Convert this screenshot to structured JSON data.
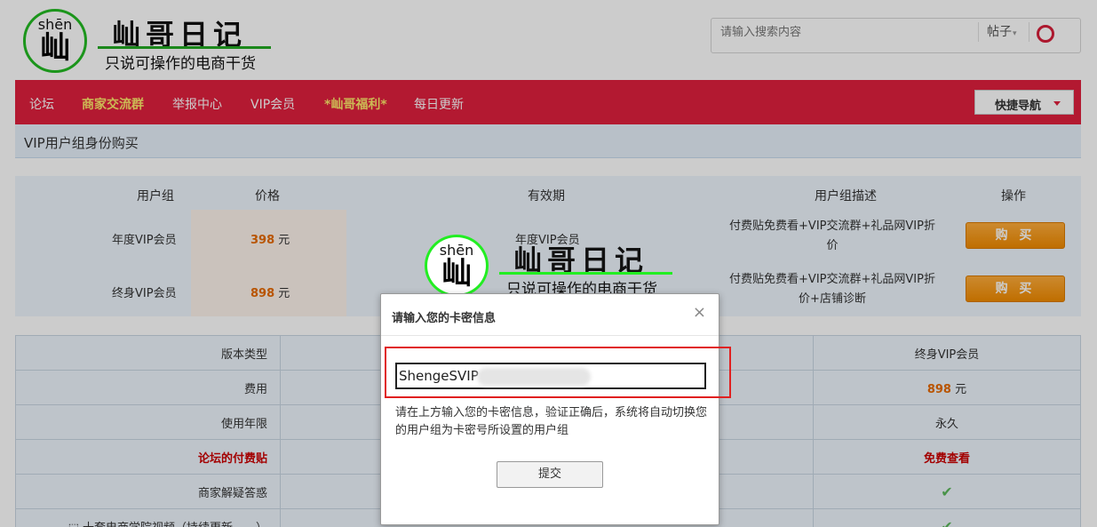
{
  "logo": {
    "pinyin": "shēn",
    "char": "屾",
    "name": "屾哥日记",
    "slogan": "只说可操作的电商干货"
  },
  "search": {
    "placeholder": "请输入搜索内容",
    "type": "帖子"
  },
  "nav": {
    "items": [
      "论坛",
      "商家交流群",
      "举报中心",
      "VIP会员",
      "*屾哥福利*",
      "每日更新"
    ],
    "quick": "快捷导航"
  },
  "subbar": "VIP用户组身份购买",
  "price_table": {
    "headers": [
      "用户组",
      "价格",
      "有效期",
      "用户组描述",
      "操作"
    ],
    "rows": [
      {
        "group": "年度VIP会员",
        "price": "398",
        "unit": "元",
        "validity": "年度VIP会员",
        "desc": "付费贴免费看+VIP交流群+礼品网VIP折价",
        "action": "购 买"
      },
      {
        "group": "终身VIP会员",
        "price": "898",
        "unit": "元",
        "desc": "付费贴免费看+VIP交流群+礼品网VIP折价+店铺诊断",
        "action": "购 买"
      }
    ]
  },
  "compare_table": {
    "header": {
      "label": "版本类型",
      "col3": "终身VIP会员"
    },
    "rows": [
      {
        "label": "费用",
        "price": "898",
        "unit": "元"
      },
      {
        "label": "使用年限",
        "value": "永久"
      },
      {
        "label": "论坛的付费贴",
        "value": "免费查看"
      },
      {
        "label": "商家解疑答惑",
        "check": "✔"
      },
      {
        "label": "⬚ 十套电商学院视频（持续更新……）",
        "check": "✔"
      }
    ]
  },
  "modal": {
    "title": "请输入您的卡密信息",
    "close": "×",
    "input_value": "ShengeSVIP",
    "hint": "请在上方输入您的卡密信息，验证正确后，系统将自动切换您的用户组为卡密号所设置的用户组",
    "submit": "提交"
  }
}
